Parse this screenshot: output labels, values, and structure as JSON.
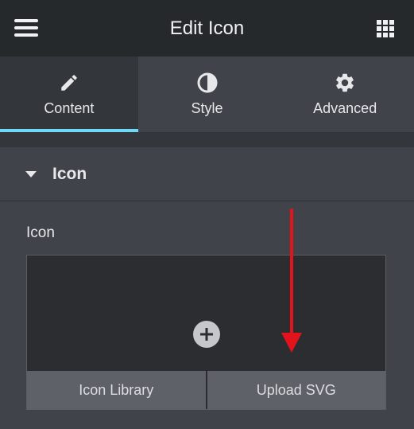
{
  "header": {
    "title": "Edit Icon",
    "menu_icon": "hamburger-icon",
    "grid_icon": "apps-grid-icon"
  },
  "tabs": [
    {
      "label": "Content",
      "icon": "pencil-icon",
      "active": true
    },
    {
      "label": "Style",
      "icon": "contrast-icon",
      "active": false
    },
    {
      "label": "Advanced",
      "icon": "gear-icon",
      "active": false
    }
  ],
  "section": {
    "title": "Icon",
    "expanded": true
  },
  "field": {
    "label": "Icon"
  },
  "picker": {
    "add_icon": "plus-circle-icon",
    "buttons": [
      "Icon Library",
      "Upload SVG"
    ]
  },
  "colors": {
    "header_bg": "#26292c",
    "panel_bg": "#404349",
    "active_tab_indicator": "#71d7f7",
    "annotation_arrow": "#e3131b"
  }
}
